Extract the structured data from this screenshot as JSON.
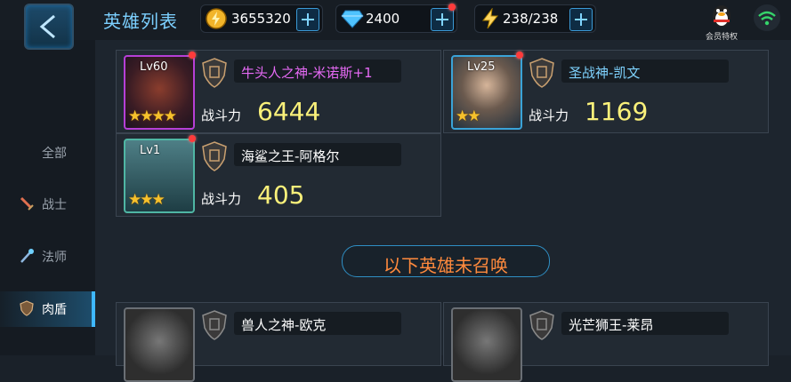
{
  "header": {
    "title": "英雄列表",
    "gold": "3655320",
    "diamonds": "2400",
    "energy": "238/238",
    "member_label": "会员特权"
  },
  "sidebar": {
    "items": [
      {
        "label": "全部"
      },
      {
        "label": "战士"
      },
      {
        "label": "法师"
      },
      {
        "label": "肉盾"
      }
    ]
  },
  "heroes": [
    {
      "level": "Lv60",
      "name": "牛头人之神-米诺斯+1",
      "power_label": "战斗力",
      "power": "6444",
      "stars": "★★★★"
    },
    {
      "level": "Lv25",
      "name": "圣战神-凯文",
      "power_label": "战斗力",
      "power": "1169",
      "stars": "★★"
    },
    {
      "level": "Lv1",
      "name": "海鲨之王-阿格尔",
      "power_label": "战斗力",
      "power": "405",
      "stars": "★★★"
    }
  ],
  "unsummoned_banner": "以下英雄未召唤",
  "locked_heroes": [
    {
      "name": "兽人之神-欧克"
    },
    {
      "name": "光芒狮王-莱昂"
    }
  ],
  "colors": {
    "accent": "#3fb8ff",
    "power": "#f9f07a",
    "banner_text": "#ff8a3d"
  }
}
